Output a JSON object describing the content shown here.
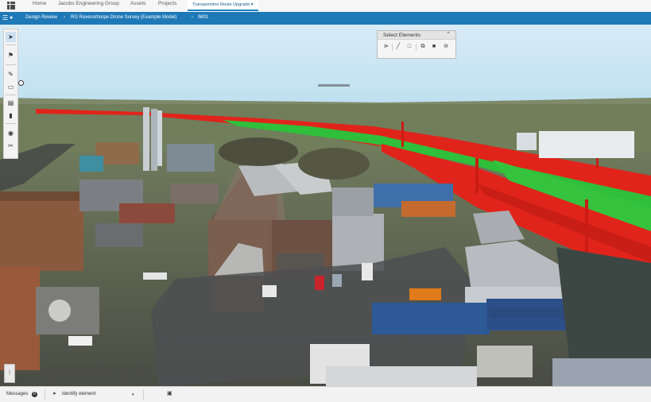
{
  "topnav": {
    "items": [
      "Home",
      "Jacobs Engineering Group",
      "Assets",
      "Projects"
    ],
    "active_tab": "Transpennine Route Upgrade"
  },
  "breadcrumb": {
    "items": [
      "Design Review",
      "RG Ravensthorpe Drone Survey (Example Model)",
      "IM01"
    ]
  },
  "select_panel": {
    "title": "Select Elements"
  },
  "bottombar": {
    "messages_label": "Messages",
    "messages_count": "0",
    "identify_label": "Identify element"
  },
  "icons": {
    "apps": "grid-icon",
    "pointer": "pointer-icon",
    "measure": "ruler-icon",
    "pen": "pen-icon",
    "box": "box-icon",
    "section": "section-icon",
    "layers": "layers-icon",
    "eye": "eye-icon",
    "cut": "cut-icon",
    "snapshot": "camera-icon"
  },
  "colors": {
    "accent": "#1f79b7",
    "model_red": "#e0241b",
    "model_green": "#2fbf3a"
  }
}
